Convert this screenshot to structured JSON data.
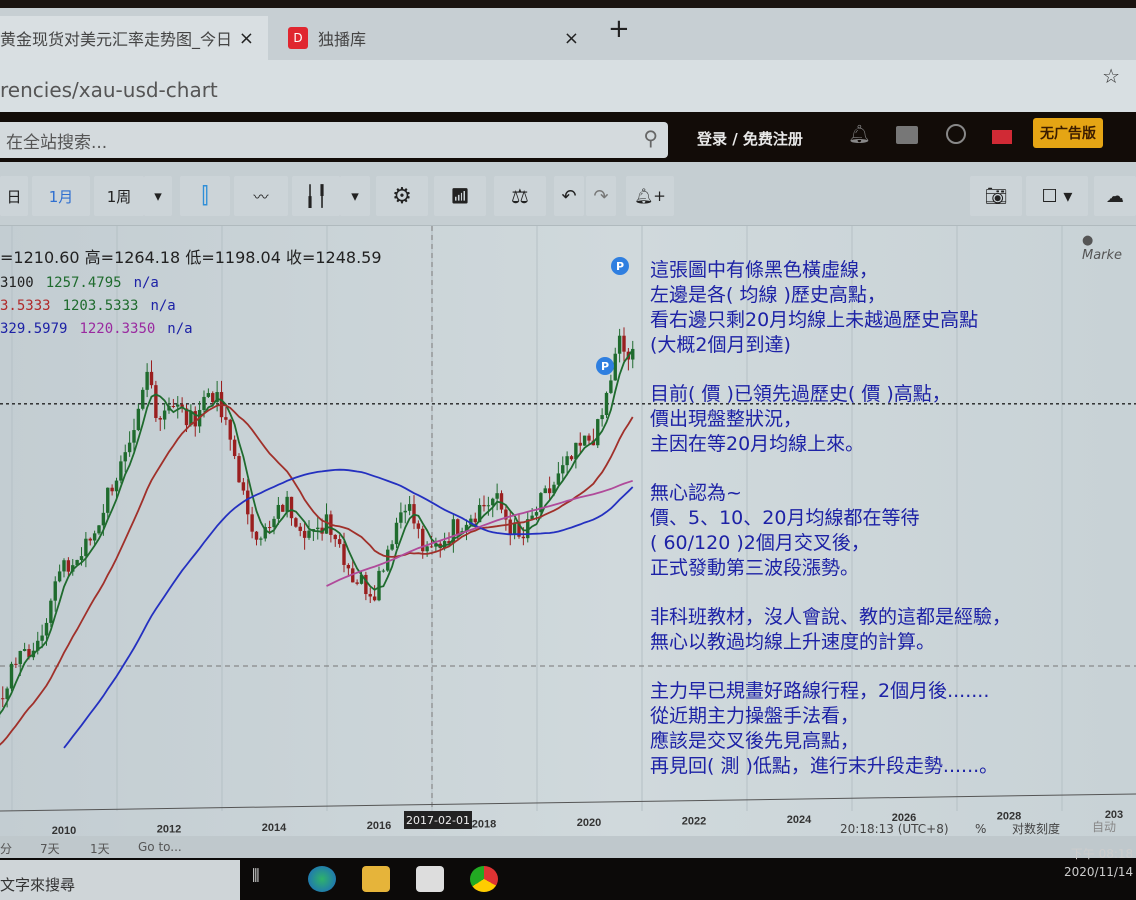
{
  "browser": {
    "tabs": [
      {
        "title": "黄金现货对美元汇率走势图_今日",
        "close": "×"
      },
      {
        "title": "独播库",
        "icon": "D",
        "close": "×"
      }
    ],
    "new_tab": "+",
    "url": "rencies/xau-usd-chart",
    "bookmark_icon": "☆"
  },
  "site_header": {
    "search_placeholder": "在全站搜索...",
    "login": "登录 / 免费注册",
    "no_ads": "无广告版"
  },
  "toolbar": {
    "periods": [
      "日",
      "1月",
      "1周"
    ],
    "active_period": "1月",
    "market": "● Marke"
  },
  "legend": {
    "ohlc": "=1210.60  高=1264.18  低=1198.04  收=1248.59",
    "rows": [
      [
        {
          "t": "3100",
          "c": "#222"
        },
        {
          "t": "1257.4795",
          "c": "#1f6b2e"
        },
        {
          "t": "n/a",
          "c": "#1d22a6"
        }
      ],
      [
        {
          "t": "3.5333",
          "c": "#b02a2a"
        },
        {
          "t": "1203.5333",
          "c": "#1f6b2e"
        },
        {
          "t": "n/a",
          "c": "#1d22a6"
        }
      ],
      [
        {
          "t": "329.5979",
          "c": "#1d22a6"
        },
        {
          "t": "1220.3350",
          "c": "#9a2aa0"
        },
        {
          "t": "n/a",
          "c": "#1d22a6"
        }
      ]
    ]
  },
  "notes": [
    [
      "這張圖中有條黑色橫虛線，",
      "左邊是各( 均線 )歷史高點，",
      "看右邊只剩20月均線上未越過歷史高點",
      "(大概2個月到達)"
    ],
    [
      "目前( 價 )已領先過歷史( 價 )高點，",
      "價出現盤整狀況，",
      "主因在等20月均線上來。"
    ],
    [
      "無心認為~",
      "價、5、10、20月均線都在等待",
      "( 60/120 )2個月交叉後，",
      "正式發動第三波段漲勢。"
    ],
    [
      "非科班教材，沒人會說、教的這都是經驗，",
      "無心以教過均線上升速度的計算。"
    ],
    [
      "主力早已規畫好路線行程，2個月後.......",
      "從近期主力操盤手法看，",
      "應該是交叉後先見高點，",
      "再見回( 測 )低點，進行末升段走勢......。"
    ]
  ],
  "chart_data": {
    "type": "candlestick",
    "title": "XAU/USD monthly",
    "scale": "log",
    "x_ticks": [
      "2010",
      "2012",
      "2014",
      "2016",
      "2018",
      "2020",
      "2022",
      "2024",
      "2026",
      "2028",
      "203"
    ],
    "crosshair_label": "2017-02-01",
    "key_points": [
      [
        2008.8,
        800
      ],
      [
        2009.0,
        880
      ],
      [
        2009.5,
        940
      ],
      [
        2009.9,
        1100
      ],
      [
        2010.3,
        1150
      ],
      [
        2010.6,
        1230
      ],
      [
        2010.9,
        1380
      ],
      [
        2011.3,
        1500
      ],
      [
        2011.6,
        1820
      ],
      [
        2011.8,
        1620
      ],
      [
        2012.0,
        1700
      ],
      [
        2012.4,
        1600
      ],
      [
        2012.8,
        1750
      ],
      [
        2013.3,
        1450
      ],
      [
        2013.5,
        1250
      ],
      [
        2013.9,
        1220
      ],
      [
        2014.2,
        1320
      ],
      [
        2014.8,
        1200
      ],
      [
        2015.0,
        1280
      ],
      [
        2015.5,
        1100
      ],
      [
        2015.9,
        1060
      ],
      [
        2016.5,
        1330
      ],
      [
        2016.9,
        1150
      ],
      [
        2017.5,
        1250
      ],
      [
        2017.9,
        1300
      ],
      [
        2018.2,
        1330
      ],
      [
        2018.7,
        1190
      ],
      [
        2019.0,
        1290
      ],
      [
        2019.5,
        1420
      ],
      [
        2019.9,
        1520
      ],
      [
        2020.2,
        1580
      ],
      [
        2020.6,
        1970
      ],
      [
        2020.7,
        1880
      ],
      [
        2020.85,
        1880
      ]
    ],
    "moving_averages": [
      {
        "period": 5,
        "color": "#1f6b2e"
      },
      {
        "period": 20,
        "color": "#a0302a"
      },
      {
        "period": 60,
        "color": "#2430c0"
      },
      {
        "period": 120,
        "color": "#b04a9a"
      }
    ],
    "reference_line": 1680,
    "markers": [
      "P",
      "P"
    ]
  },
  "bottom": {
    "ranges": [
      "分",
      "7天",
      "1天",
      "Go to..."
    ],
    "time": "20:18:13 (UTC+8)",
    "percent": "%",
    "log": "对数刻度",
    "auto": "自动"
  },
  "taskbar": {
    "search": "文字來搜尋",
    "time": "下午 08:18",
    "date": "2020/11/14"
  }
}
